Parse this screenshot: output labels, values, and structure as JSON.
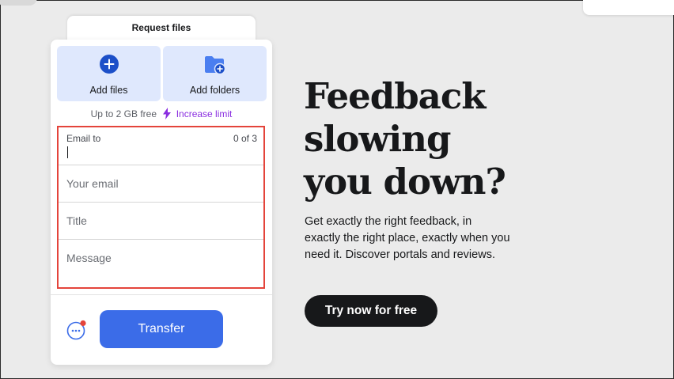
{
  "colors": {
    "page_bg": "#ebebeb",
    "tile_bg": "#dfe8fd",
    "accent_blue": "#3b6ce8",
    "icon_blue": "#1c4fc8",
    "purple": "#8a2ee0",
    "highlight_red": "#e4443b",
    "dark": "#17181a"
  },
  "panel": {
    "tab_label": "Request files",
    "add_files": {
      "label": "Add files",
      "icon": "plus-circle-icon"
    },
    "add_folders": {
      "label": "Add folders",
      "icon": "folder-plus-icon"
    },
    "limit": {
      "text": "Up to 2 GB free",
      "icon": "lightning-icon",
      "link": "Increase limit"
    },
    "form": {
      "email_to_label": "Email to",
      "email_to_counter": "0 of 3",
      "email_to_value": "",
      "your_email_placeholder": "Your email",
      "title_placeholder": "Title",
      "message_placeholder": "Message"
    },
    "more_icon": "more-options-icon",
    "transfer_label": "Transfer"
  },
  "promo": {
    "headline": [
      "Feedback",
      "slowing",
      "you down?"
    ],
    "body": "Get exactly the right feedback, in exactly the right place, exactly when you need it. Discover portals and reviews.",
    "cta": "Try now for free"
  }
}
